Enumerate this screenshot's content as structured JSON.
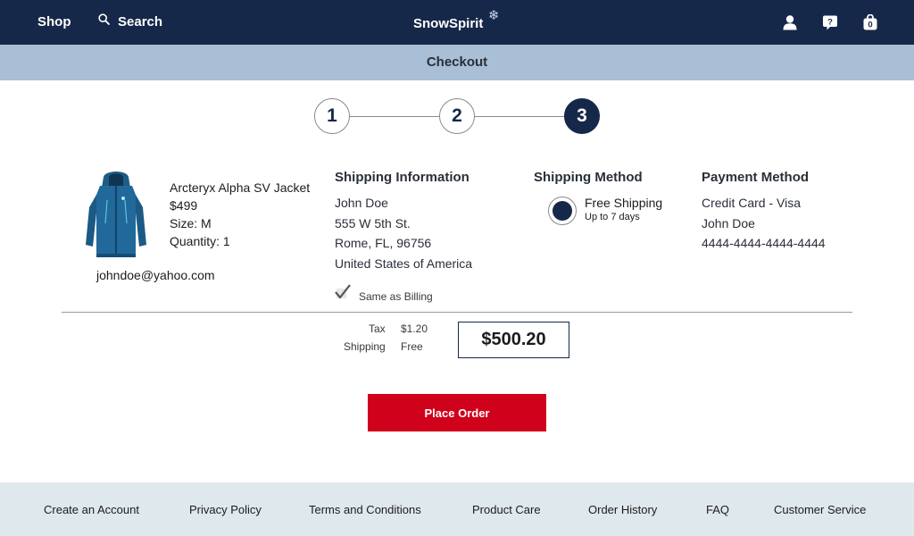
{
  "nav": {
    "shop": "Shop",
    "search": "Search",
    "brand": "SnowSpirit",
    "icons": [
      "user-icon",
      "help-icon",
      "bag-icon"
    ],
    "bag_count": "0",
    "help_mark": "?",
    "colors": {
      "navy": "#16284a",
      "accent_red": "#d0021b",
      "subbar": "#a8bfd5",
      "footer": "#dfe8ec"
    }
  },
  "checkout_bar": {
    "title": "Checkout"
  },
  "stepper": {
    "steps": [
      "1",
      "2",
      "3"
    ],
    "active": 3
  },
  "product": {
    "name": "Arcteryx Alpha SV Jacket",
    "price": "$499",
    "size": "Size: M",
    "quantity": "Quantity: 1",
    "email": "johndoe@yahoo.com"
  },
  "shipping_info": {
    "title": "Shipping Information",
    "name": "John Doe",
    "street": "555 W 5th St.",
    "city": "Rome, FL, 96756",
    "country": "United States of America",
    "same_as_billing": "Same as Billing",
    "same_as_billing_checked": true
  },
  "shipping_method": {
    "title": "Shipping Method",
    "option_name": "Free Shipping",
    "option_detail": "Up to 7 days",
    "selected": true
  },
  "payment_method": {
    "title": "Payment Method",
    "type": "Credit Card - Visa",
    "name": "John Doe",
    "card_number": "4444-4444-4444-4444"
  },
  "totals": {
    "tax_label": "Tax",
    "tax_value": "$1.20",
    "shipping_label": "Shipping",
    "shipping_value": "Free",
    "total": "$500.20"
  },
  "place_order_label": "Place Order",
  "footer": {
    "links": [
      "Create an Account",
      "Privacy Policy",
      "Terms and Conditions",
      "Product Care",
      "Order History",
      "FAQ",
      "Customer Service"
    ]
  }
}
